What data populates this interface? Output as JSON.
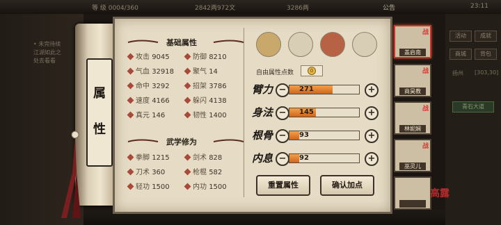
{
  "topbar": {
    "level": "等 级 0004/360",
    "money": "2842两972文",
    "gold": "3286两",
    "notice": "公告",
    "time": "23:11"
  },
  "quest": {
    "title": "• 未完待续",
    "line1": "江湖如此之",
    "line2": "处去看看"
  },
  "right_menu": {
    "btn1": "活动",
    "btn2": "成就",
    "btn3": "商城",
    "btn4": "背包",
    "area": "扬州",
    "coords": "[303,30]",
    "stone": "青石大道"
  },
  "scroll_title": [
    "属",
    "性"
  ],
  "basic": {
    "title": "基础属性",
    "stats": [
      {
        "label": "攻击",
        "value": "9045"
      },
      {
        "label": "防御",
        "value": "8210"
      },
      {
        "label": "气血",
        "value": "32918"
      },
      {
        "label": "聚气",
        "value": "14"
      },
      {
        "label": "命中",
        "value": "3292"
      },
      {
        "label": "招架",
        "value": "3786"
      },
      {
        "label": "速度",
        "value": "4166"
      },
      {
        "label": "躲闪",
        "value": "4138"
      },
      {
        "label": "真元",
        "value": "146"
      },
      {
        "label": "韧性",
        "value": "1400"
      }
    ]
  },
  "martial": {
    "title": "武学修为",
    "stats": [
      {
        "label": "拳脚",
        "value": "1215"
      },
      {
        "label": "剑术",
        "value": "828"
      },
      {
        "label": "刀术",
        "value": "360"
      },
      {
        "label": "枪棍",
        "value": "582"
      },
      {
        "label": "轻功",
        "value": "1500"
      },
      {
        "label": "内功",
        "value": "1500"
      }
    ]
  },
  "free_points": {
    "label": "自由属性点数",
    "value": "0"
  },
  "attributes": [
    {
      "label": "臂力",
      "value": "271",
      "fill": 0.62
    },
    {
      "label": "身法",
      "value": "145",
      "fill": 0.38
    },
    {
      "label": "根骨",
      "value": "93",
      "fill": 0.14
    },
    {
      "label": "内息",
      "value": "92",
      "fill": 0.14
    }
  ],
  "buttons": {
    "reset": "重置属性",
    "confirm": "确认加点"
  },
  "heroes": [
    {
      "name": "盖启南",
      "badge": "战",
      "selected": true
    },
    {
      "name": "商昊教",
      "badge": "战"
    },
    {
      "name": "林妮娴",
      "badge": "战"
    },
    {
      "name": "巫灵儿",
      "badge": "战"
    },
    {
      "name": "",
      "badge": ""
    }
  ],
  "signature": "高露"
}
